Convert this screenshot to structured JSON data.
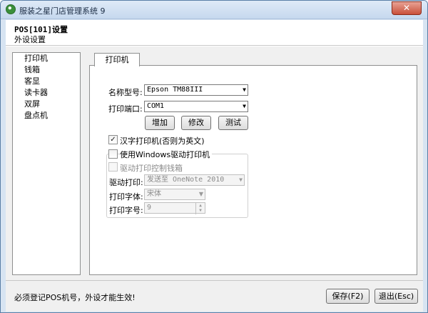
{
  "window": {
    "title": "服装之星门店管理系统 9",
    "close_label": "✕"
  },
  "header": {
    "title": "POS[101]设置",
    "subtitle": "外设设置"
  },
  "nav": {
    "items": [
      {
        "label": "打印机",
        "selected": true
      },
      {
        "label": "钱箱",
        "selected": false
      },
      {
        "label": "客显",
        "selected": false
      },
      {
        "label": "读卡器",
        "selected": false
      },
      {
        "label": "双屏",
        "selected": false
      },
      {
        "label": "盘点机",
        "selected": false
      }
    ]
  },
  "tab": {
    "label": "打印机"
  },
  "printer": {
    "model_label": "名称型号:",
    "model_value": "Epson TM88III",
    "port_label": "打印端口:",
    "port_value": "COM1",
    "add_label": "增加",
    "edit_label": "修改",
    "test_label": "测试",
    "chinese_printer_label": "汉字打印机(否则为英文)",
    "chinese_printer_checked": true,
    "use_windows_driver_label": "使用Windows驱动打印机",
    "use_windows_driver_checked": false,
    "drive_cashbox_label": "驱动打印控制钱箱",
    "drive_cashbox_checked": false,
    "driver_print_label": "驱动打印:",
    "driver_print_value": "发送至 OneNote 2010",
    "font_label": "打印字体:",
    "font_value": "宋体",
    "font_size_label": "打印字号:",
    "font_size_value": "9"
  },
  "footer": {
    "message": "必须登记POS机号，外设才能生效!",
    "save_label": "保存(F2)",
    "exit_label": "退出(Esc)"
  }
}
